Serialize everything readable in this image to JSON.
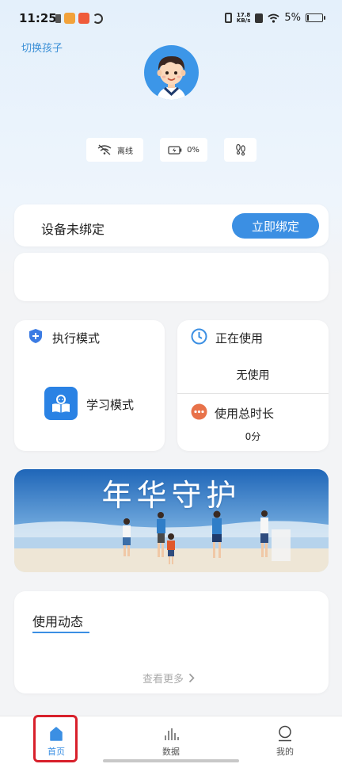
{
  "status_bar": {
    "time": "11:25",
    "net_speed_value": "17.8",
    "net_speed_unit": "KB/s",
    "battery_text": "5%",
    "battery_level": 0.05
  },
  "header": {
    "switch_child": "切换孩子",
    "device_status": {
      "network": "离线",
      "battery": "0%"
    },
    "icons": {
      "wifi": "wifi-off-icon",
      "battery": "battery-charging-icon",
      "steps": "footprints-icon"
    }
  },
  "bind_card": {
    "label": "设备未绑定",
    "button": "立即绑定"
  },
  "mode_card": {
    "title": "执行模式",
    "mode_name": "学习模式",
    "icons": {
      "title": "shield-plus-icon",
      "mode": "book-reader-icon"
    }
  },
  "usage_card": {
    "current_title": "正在使用",
    "current_value": "无使用",
    "total_title": "使用总时长",
    "total_value": "0分",
    "icons": {
      "current": "clock-icon",
      "total": "more-dots-icon"
    }
  },
  "banner": {
    "title": "年华守护"
  },
  "activity": {
    "title": "使用动态",
    "see_more": "查看更多"
  },
  "tabbar": {
    "tabs": [
      {
        "label": "首页",
        "icon": "home-icon",
        "active": true
      },
      {
        "label": "数据",
        "icon": "bar-chart-icon",
        "active": false
      },
      {
        "label": "我的",
        "icon": "person-icon",
        "active": false
      }
    ]
  },
  "colors": {
    "accent": "#3b8fe3",
    "highlight": "#d8202b",
    "usage_icon": "#3b8fe3",
    "total_icon": "#e8724a"
  }
}
